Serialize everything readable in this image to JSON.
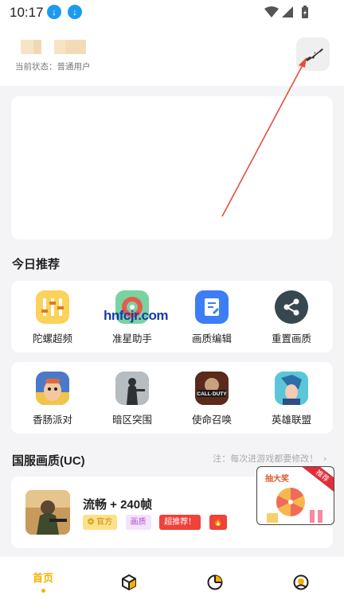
{
  "status_bar": {
    "time": "10:17"
  },
  "header": {
    "user_state": "当前状态：普通用户",
    "tool_icon": "rifle-icon"
  },
  "today": {
    "title": "今日推荐",
    "row1": [
      {
        "label": "陀螺超频",
        "icon": "gyro-overclock-icon"
      },
      {
        "label": "准星助手",
        "icon": "crosshair-assistant-icon"
      },
      {
        "label": "画质编辑",
        "icon": "quality-edit-icon"
      },
      {
        "label": "重置画质",
        "icon": "share-reset-icon"
      }
    ],
    "row2": [
      {
        "label": "香肠派对",
        "icon": "sausage-party-game-icon"
      },
      {
        "label": "暗区突围",
        "icon": "arena-breakout-game-icon"
      },
      {
        "label": "使命召唤",
        "icon": "call-of-duty-game-icon"
      },
      {
        "label": "英雄联盟",
        "icon": "league-of-legends-game-icon"
      }
    ],
    "watermark": "hnfcjr.com"
  },
  "china_server": {
    "title": "国服画质(UC)",
    "note": "注：每次进游戏都要修改！",
    "item": {
      "title": "流畅 + 240帧",
      "badges": [
        "官方",
        "画质",
        "超推荐！"
      ],
      "icon": "pubg-game-icon"
    },
    "prize": {
      "label": "抽大奖",
      "ribbon": "推荐"
    }
  },
  "bottom_nav": {
    "home": "首页",
    "icons": [
      "cube-icon",
      "pie-chart-icon",
      "profile-icon"
    ]
  },
  "colors": {
    "accent": "#f5b100",
    "arrow": "#e0513a",
    "download": "#1a9bf0"
  }
}
